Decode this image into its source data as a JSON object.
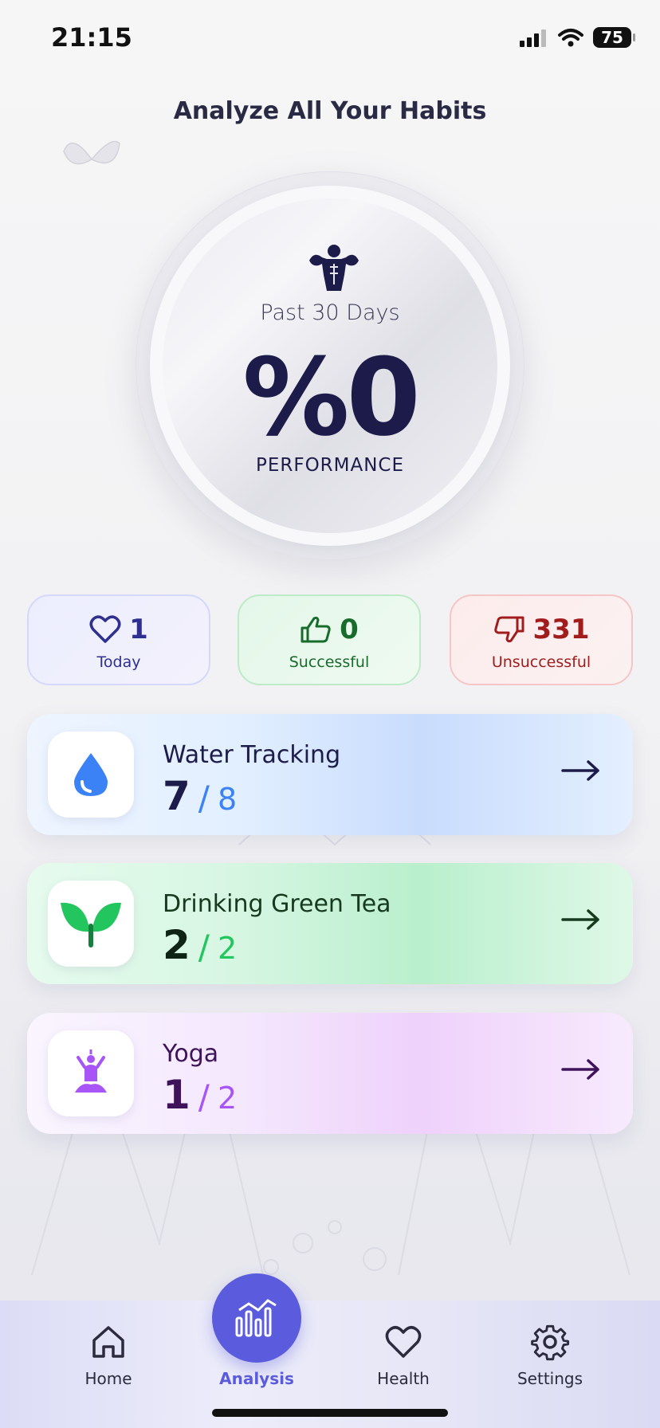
{
  "status_bar": {
    "time": "21:15",
    "battery": "75"
  },
  "page": {
    "title": "Analyze All Your Habits"
  },
  "performance": {
    "period": "Past 30 Days",
    "value": "%0",
    "label": "PERFORMANCE"
  },
  "stats": [
    {
      "value": "1",
      "label": "Today",
      "icon": "heart-icon",
      "color": "#2f2f8f"
    },
    {
      "value": "0",
      "label": "Successful",
      "icon": "thumbs-up-icon",
      "color": "#176b2b"
    },
    {
      "value": "331",
      "label": "Unsuccessful",
      "icon": "thumbs-down-icon",
      "color": "#a11d1d"
    }
  ],
  "habits": [
    {
      "name": "Water Tracking",
      "done": "7",
      "total": "8",
      "separator": "/",
      "icon": "water-drop-icon",
      "accent": "#3b82f6"
    },
    {
      "name": "Drinking Green Tea",
      "done": "2",
      "total": "2",
      "separator": "/",
      "icon": "leaf-sprout-icon",
      "accent": "#22c55e"
    },
    {
      "name": "Yoga",
      "done": "1",
      "total": "2",
      "separator": "/",
      "icon": "yoga-icon",
      "accent": "#a855f7"
    }
  ],
  "nav": [
    {
      "label": "Home",
      "icon": "home-icon"
    },
    {
      "label": "Analysis",
      "icon": "analysis-chart-icon",
      "active": true
    },
    {
      "label": "Health",
      "icon": "heart-icon"
    },
    {
      "label": "Settings",
      "icon": "gear-icon"
    }
  ],
  "colors": {
    "primary": "#5b5cdd",
    "text_dark": "#1c1b4a"
  }
}
